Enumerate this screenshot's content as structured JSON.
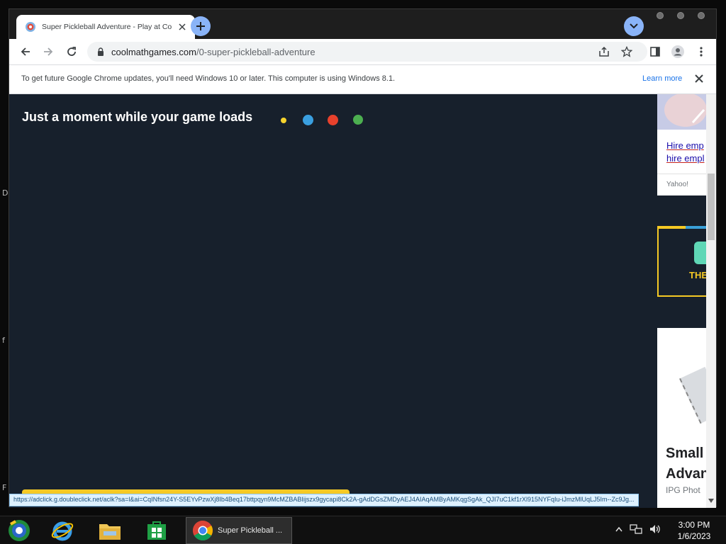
{
  "desktop": {
    "side_letters": [
      "D",
      "f",
      "F"
    ]
  },
  "tab": {
    "title": "Super Pickleball Adventure - Play at Co",
    "favicon": "coolmath-favicon"
  },
  "omnibox": {
    "domain": "coolmathgames.com",
    "path": "/0-super-pickleball-adventure"
  },
  "infobar": {
    "message": "To get future Google Chrome updates, you'll need Windows 10 or later. This computer is using Windows 8.1.",
    "link": "Learn more"
  },
  "page": {
    "loading_text": "Just a moment while your game loads",
    "dot_colors": [
      "#f6d32d",
      "#3a9fe0",
      "#e8412c",
      "#4caf50"
    ],
    "background": "#17202c"
  },
  "ads": {
    "ad1_link_line1": "Hire emp",
    "ad1_link_line2": "hire empl",
    "ad1_source": "Yahoo!",
    "ad2_text": "THE",
    "ad3_title_line1": "Small",
    "ad3_title_line2": "Advan",
    "ad3_sub": "IPG Phot"
  },
  "statusbar": {
    "url": "https://adclick.g.doubleclick.net/aclk?sa=l&ai=CqINfsn24Y-S5EYvPzwXj8Ib4Beq17bttpqyn9McMZBABIijszx9gycapi8Ck2A-gAdDGsZMDyAEJ4AIAqAMByAMKqgSgAk_QJI7uC1kf1rXl915NYFqIu-iJmzMlUqLJ5Im--Zc9Jg..."
  },
  "taskbar": {
    "chrome_label": "Super Pickleball ...",
    "time": "3:00 PM",
    "date": "1/6/2023"
  }
}
